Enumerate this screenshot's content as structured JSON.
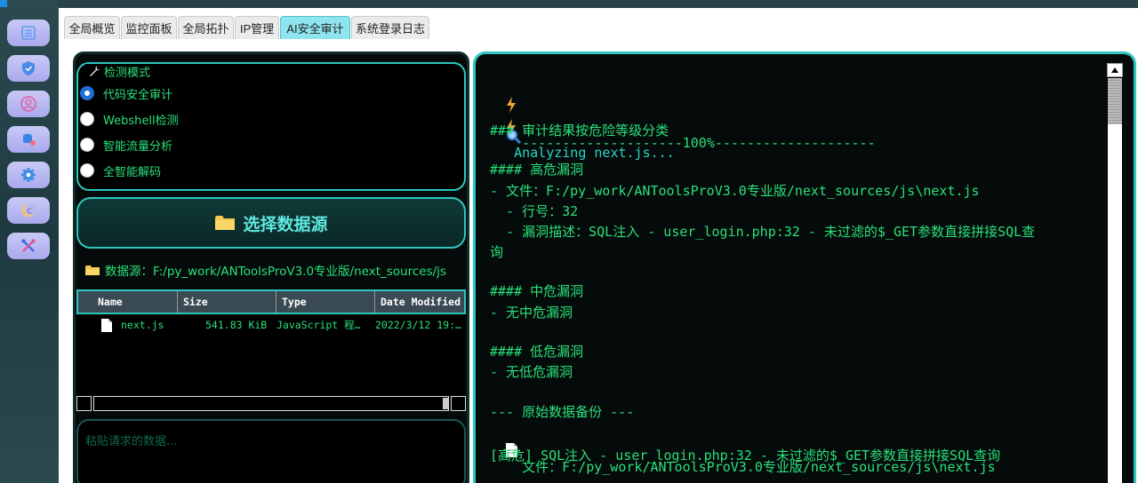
{
  "tabs": [
    {
      "label": "全局概览"
    },
    {
      "label": "监控面板"
    },
    {
      "label": "全局拓扑"
    },
    {
      "label": "IP管理"
    },
    {
      "label": "AI安全审计",
      "active": true
    },
    {
      "label": "系统登录日志"
    }
  ],
  "sidebar": {
    "items": [
      {
        "icon": "list-icon"
      },
      {
        "icon": "shield-icon"
      },
      {
        "icon": "user-icon"
      },
      {
        "icon": "database-icon"
      },
      {
        "icon": "gear-icon"
      },
      {
        "icon": "moon-icon"
      },
      {
        "icon": "tools-icon"
      }
    ]
  },
  "detect_mode": {
    "legend": "检测模式",
    "options": [
      {
        "label": "代码安全审计",
        "checked": true
      },
      {
        "label": "Webshell检测",
        "checked": false
      },
      {
        "label": "智能流量分析",
        "checked": false
      },
      {
        "label": "全智能解码",
        "checked": false
      }
    ]
  },
  "source_button": {
    "label": "选择数据源"
  },
  "source_path": "数据源：F:/py_work/ANToolsProV3.0专业版/next_sources/js",
  "file_table": {
    "columns": [
      "Name",
      "Size",
      "Type",
      "Date Modified"
    ],
    "rows": [
      {
        "name": "next.js",
        "size": "541.83 KiB",
        "type": "JavaScript 程…",
        "date": "2022/3/12 19:…"
      }
    ]
  },
  "paste_placeholder": "粘贴请求的数据...",
  "output": {
    "analyzing": "Analyzing next.js...",
    "progress": "--------------------100%--------------------",
    "lines": [
      "### 审计结果按危险等级分类",
      "#### 高危漏洞",
      "- 文件：F:/py_work/ANToolsProV3.0专业版/next_sources/js\\next.js",
      "  - 行号：32",
      "  - 漏洞描述：SQL注入 - user_login.php:32 - 未过滤的$_GET参数直接拼接SQL查",
      "询",
      "#### 中危漏洞",
      "- 无中危漏洞",
      "#### 低危漏洞",
      "- 无低危漏洞",
      "--- 原始数据备份 ---",
      "文件：F:/py_work/ANToolsProV3.0专业版/next_sources/js\\next.js",
      "[高危] SQL注入 - user_login.php:32 - 未过滤的$_GET参数直接拼接SQL查询"
    ]
  },
  "colors": {
    "accent_cyan": "#2dc7bf",
    "text_green": "#2ae07a",
    "panel_bg": "#050b0a",
    "sidebar_button": "#b9b9f2"
  }
}
